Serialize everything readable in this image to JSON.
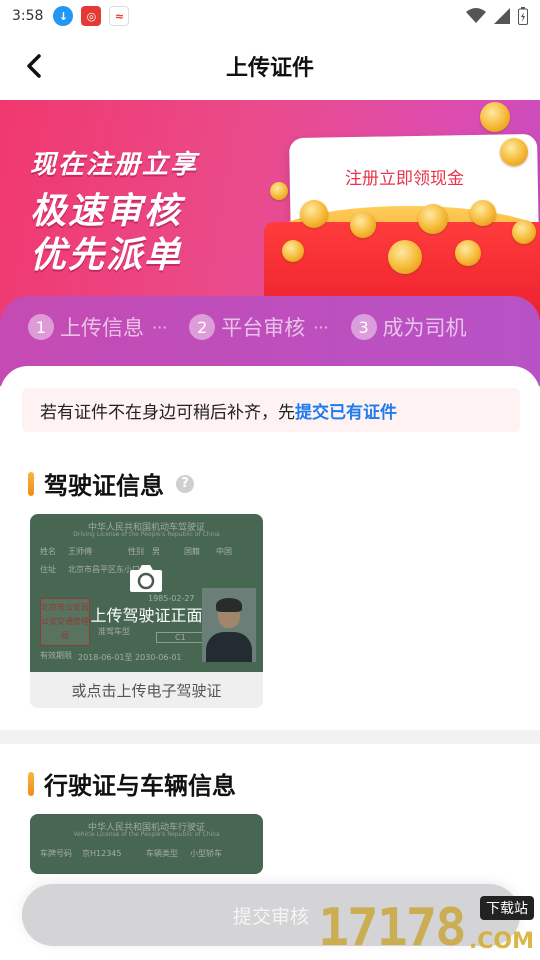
{
  "status_bar": {
    "time": "3:58"
  },
  "nav": {
    "title": "上传证件"
  },
  "banner": {
    "line1": "现在注册立享",
    "line2": "极速审核",
    "line3": "优先派单",
    "card_text": "注册立即领现金"
  },
  "steps": [
    {
      "num": "1",
      "label": "上传信息",
      "dots": "···"
    },
    {
      "num": "2",
      "label": "平台审核",
      "dots": "···"
    },
    {
      "num": "3",
      "label": "成为司机",
      "dots": ""
    }
  ],
  "notice": {
    "text": "若有证件不在身边可稍后补齐，先",
    "link": "提交已有证件"
  },
  "driver_license": {
    "section_title": "驾驶证信息",
    "help": "?",
    "upload_label": "上传驾驶证正面",
    "alt_upload": "或点击上传电子驾驶证",
    "sample": {
      "heading": "中华人民共和国机动车驾驶证",
      "subheading": "Driving License of the People's Republic of China",
      "name_label": "姓名",
      "name": "王师傅",
      "sex_label": "性别",
      "sex": "男",
      "nation_label": "国籍",
      "nation": "中国",
      "address_label": "住址",
      "address": "北京市昌平区东小口区",
      "birth": "1985-02-27",
      "class_label": "准驾车型",
      "class": "C1",
      "valid_label": "有效期限",
      "valid": "2018-06-01至 2030-06-01",
      "seal": "北京市公安局公安交通管理局"
    }
  },
  "vehicle_license": {
    "section_title": "行驶证与车辆信息",
    "sample": {
      "heading": "中华人民共和国机动车行驶证",
      "subheading": "Vehicle License of the People's Republic of China",
      "plate_label": "车牌号码",
      "plate": "京H12345",
      "type_label": "车辆类型",
      "type": "小型轿车"
    }
  },
  "submit": {
    "label": "提交审核"
  },
  "watermark": {
    "number": "17178",
    "badge": "下载站",
    "domain": ".COM"
  },
  "colors": {
    "accent": "#1f7cf0",
    "banner_start": "#f0386e",
    "banner_end": "#c64bc4",
    "section_bar": "#f5a630"
  }
}
